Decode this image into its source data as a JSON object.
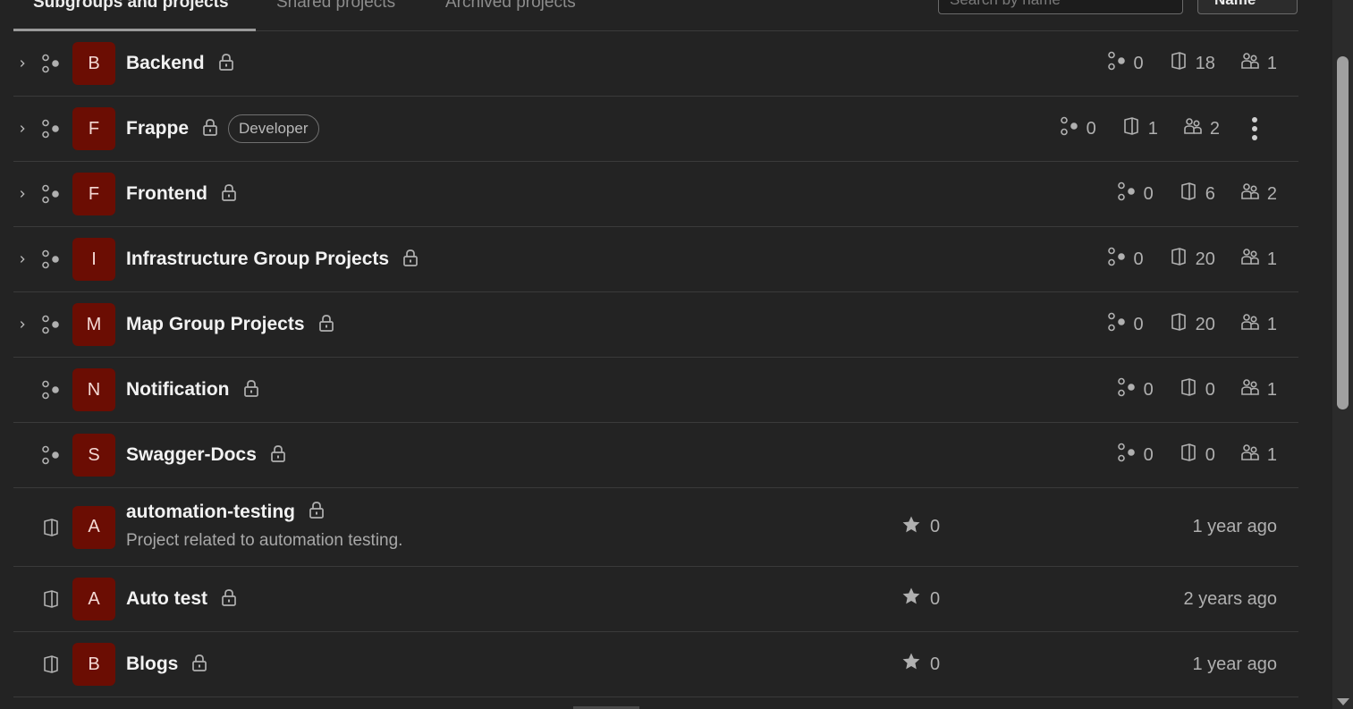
{
  "tabs": [
    {
      "label": "Subgroups and projects",
      "active": true
    },
    {
      "label": "Shared projects",
      "active": false
    },
    {
      "label": "Archived projects",
      "active": false
    }
  ],
  "search": {
    "placeholder": "Search by name"
  },
  "sort": {
    "label": "Name"
  },
  "groups": [
    {
      "initial": "B",
      "name": "Backend",
      "subgroups": "0",
      "projects": "18",
      "members": "1"
    },
    {
      "initial": "F",
      "name": "Frappe",
      "role": "Developer",
      "subgroups": "0",
      "projects": "1",
      "members": "2"
    },
    {
      "initial": "F",
      "name": "Frontend",
      "subgroups": "0",
      "projects": "6",
      "members": "2"
    },
    {
      "initial": "I",
      "name": "Infrastructure Group Projects",
      "subgroups": "0",
      "projects": "20",
      "members": "1"
    },
    {
      "initial": "M",
      "name": "Map Group Projects",
      "subgroups": "0",
      "projects": "20",
      "members": "1"
    },
    {
      "initial": "N",
      "name": "Notification",
      "subgroups": "0",
      "projects": "0",
      "members": "1"
    },
    {
      "initial": "S",
      "name": "Swagger-Docs",
      "subgroups": "0",
      "projects": "0",
      "members": "1"
    }
  ],
  "projects": [
    {
      "initial": "A",
      "name": "automation-testing",
      "description": "Project related to automation testing.",
      "stars": "0",
      "updated": "1 year ago"
    },
    {
      "initial": "A",
      "name": "Auto test",
      "stars": "0",
      "updated": "2 years ago"
    },
    {
      "initial": "B",
      "name": "Blogs",
      "stars": "0",
      "updated": "1 year ago"
    }
  ],
  "colors": {
    "avatar_bg": "#6b0d03",
    "background": "#232323",
    "divider": "#3a3a3a"
  },
  "icons": {
    "subgroup": "subgroup-icon",
    "project": "project-icon",
    "member": "users-icon",
    "lock": "lock-icon",
    "star": "star-icon",
    "chevron": "chevron-right-icon",
    "more": "more-actions-icon"
  }
}
